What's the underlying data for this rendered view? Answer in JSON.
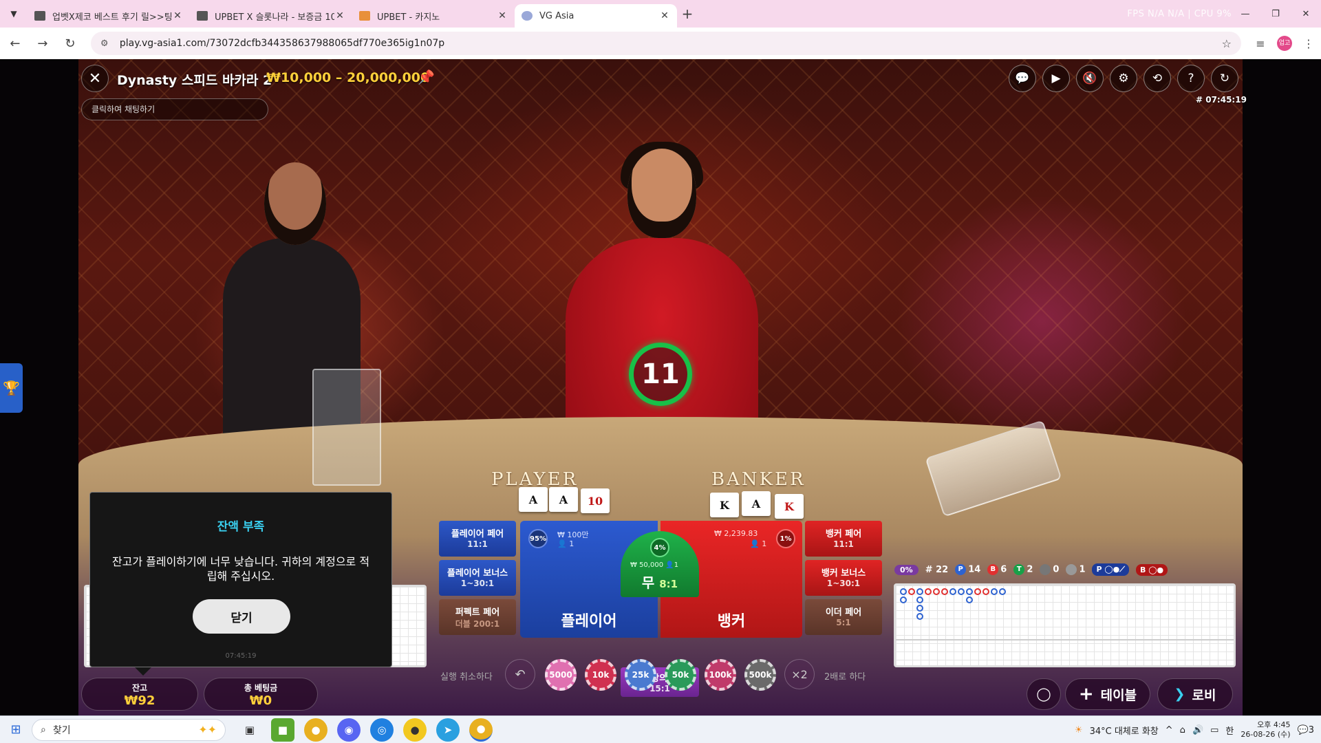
{
  "browser": {
    "tabs": [
      {
        "label": "업벳X제코 베스트 후기 릴>>팅",
        "active": false
      },
      {
        "label": "UPBET X 슬롯나라 - 보증금 10",
        "active": false
      },
      {
        "label": "UPBET - 카지노",
        "active": false
      },
      {
        "label": "VG Asia",
        "active": true
      }
    ],
    "new_tab": "+",
    "sysinfo": "FPS N/A N/A | CPU 9%",
    "url": "play.vg-asia1.com/73072dcfb344358637988065df770e365ig1n07p",
    "profile": "업고"
  },
  "game": {
    "table_title": "Dynasty 스피드 바카라 2",
    "table_limit": "₩10,000 – 20,000,000",
    "chat_placeholder": "클릭하여 채팅하기",
    "round_id": "# 07:45:19",
    "timer": "11",
    "felt_player": "PLAYER",
    "felt_banker": "BANKER",
    "player_cards": [
      "A",
      "A",
      "10"
    ],
    "banker_cards": [
      "K",
      "A",
      "K"
    ]
  },
  "bets": {
    "player_pair": {
      "label": "플레이어 페어",
      "odds": "11:1"
    },
    "player_bonus": {
      "label": "플레이어 보너스",
      "odds": "1~30:1"
    },
    "perfect_pair": {
      "label": "퍼펙트 페어",
      "odds": "더블 200:1"
    },
    "banker_pair": {
      "label": "뱅커 페어",
      "odds": "11:1"
    },
    "banker_bonus": {
      "label": "뱅커 보너스",
      "odds": "1~30:1"
    },
    "either_pair": {
      "label": "이더 페어",
      "odds": "5:1"
    },
    "player": {
      "label": "플레이어",
      "pct": "95%",
      "amount": "₩ 100만",
      "count": "1"
    },
    "banker": {
      "label": "뱅커",
      "pct": "1%",
      "amount": "₩ 2,239.83",
      "count": "1"
    },
    "tie": {
      "label": "무",
      "odds": "8:1",
      "pct": "4%",
      "amount": "₩ 50,000",
      "count": "1"
    },
    "super6": {
      "label": "극상의 6",
      "odds": "15:1"
    }
  },
  "chips": {
    "undo_label": "실행 취소하다",
    "double_label": "2배로 하다",
    "double_btn": "×2",
    "values": [
      "5000",
      "10k",
      "25k",
      "50k",
      "100k",
      "500k"
    ],
    "colors": [
      "#e070b0",
      "#d03050",
      "#4a7ad0",
      "#2a9a5a",
      "#c03a6a",
      "#6a6a6a"
    ]
  },
  "stats": {
    "percent": "0%",
    "round": "# 22",
    "p": "14",
    "b": "6",
    "t": "2",
    "pp": "0",
    "bp": "1",
    "p_label": "P",
    "b_label": "B",
    "t_label": "T"
  },
  "bottom": {
    "balance_label": "잔고",
    "balance_value": "₩92",
    "total_bet_label": "총 베팅금",
    "total_bet_value": "₩0",
    "table_btn": "테이블",
    "lobby_btn": "로비"
  },
  "modal": {
    "title": "잔액 부족",
    "message": "잔고가 플레이하기에 너무 낮습니다. 귀하의 계정으로 적립해 주십시오.",
    "button": "닫기",
    "time": "07:45:19"
  },
  "taskbar": {
    "search": "찾기",
    "weather": "34°C 대체로 화창",
    "ime": "한",
    "time": "오후 4:45",
    "date": "26-08-26 (수)",
    "notif": "3"
  }
}
